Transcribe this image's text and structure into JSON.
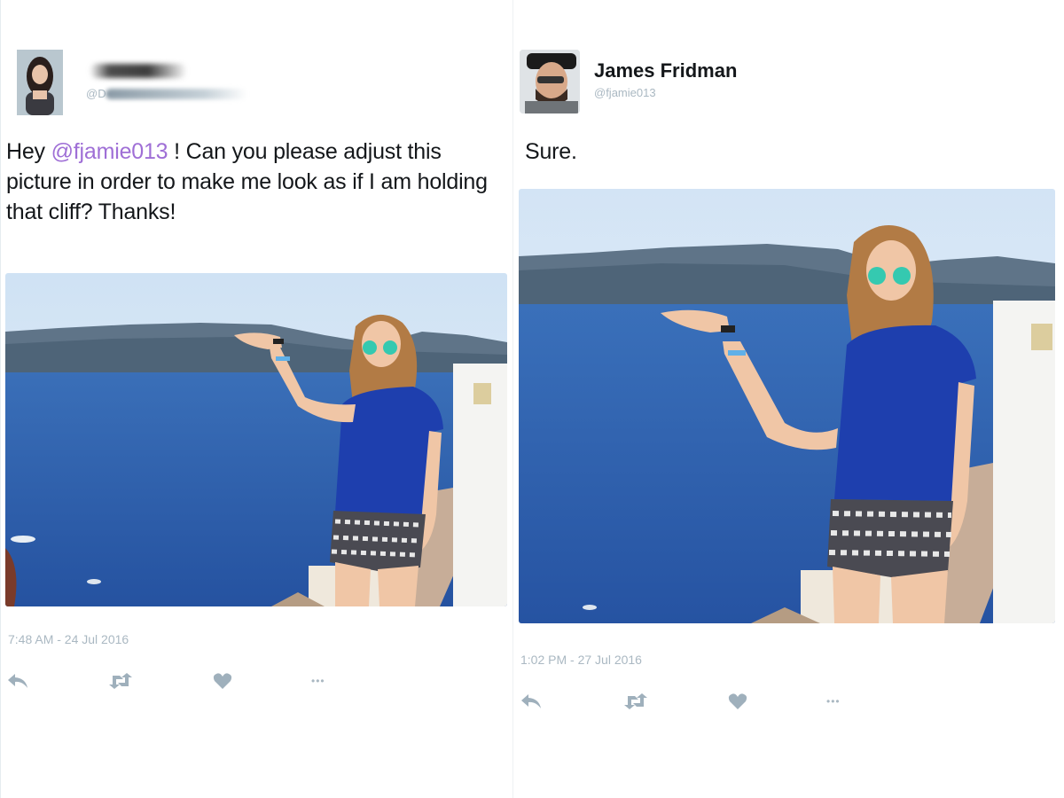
{
  "left_tweet": {
    "handle_prefix": "@D",
    "text_prefix": "Hey ",
    "mention": "@fjamie013",
    "text_suffix": " ! Can you please adjust this picture in order to make me look as if I am holding that cliff? Thanks!",
    "timestamp": "7:48 AM - 24 Jul 2016"
  },
  "right_tweet": {
    "display_name": "James Fridman",
    "screen_name": "@fjamie013",
    "text": "Sure.",
    "timestamp": "1:02 PM - 27 Jul 2016"
  },
  "actions": {
    "reply_icon": "reply-icon",
    "retweet_icon": "retweet-icon",
    "like_icon": "heart-icon",
    "more_icon": "more-icon",
    "more_glyph": "•••"
  },
  "colors": {
    "mention": "#9f6fd6",
    "meta_gray": "#aab8c2",
    "sea": "#2f63b3",
    "sky": "#dde9f6",
    "shirt": "#1e3fae"
  }
}
